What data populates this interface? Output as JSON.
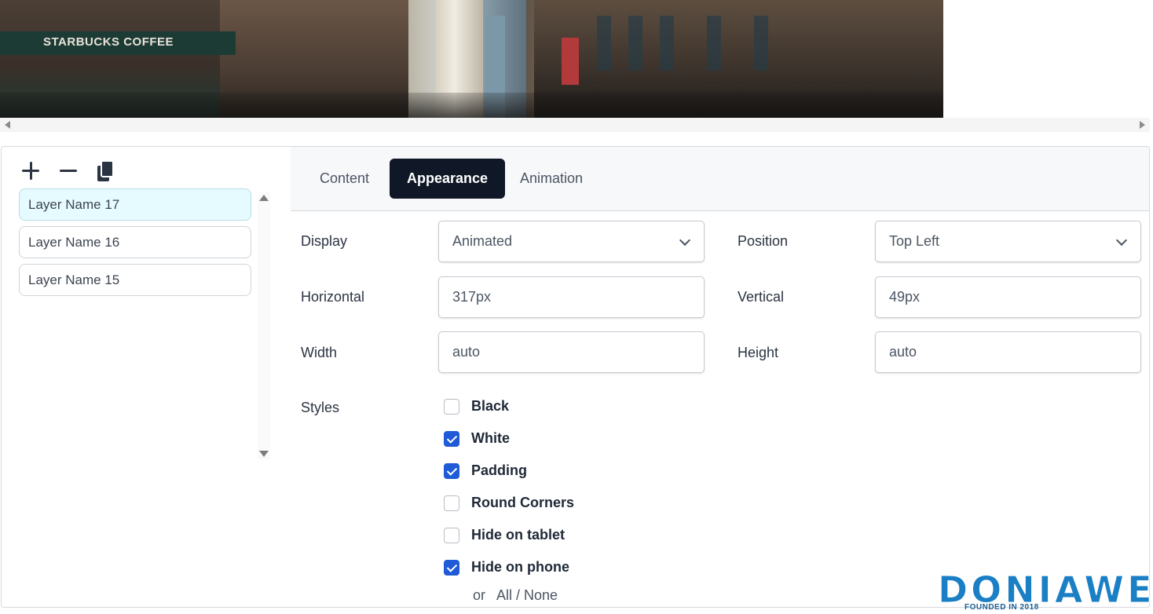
{
  "banner": {
    "sign_text": "STARBUCKS COFFEE"
  },
  "layer_tools": {
    "add_icon": "plus-icon",
    "remove_icon": "minus-icon",
    "duplicate_icon": "copy-icon"
  },
  "layers": {
    "items": [
      {
        "label": "Layer Name 17",
        "active": true
      },
      {
        "label": "Layer Name 16",
        "active": false
      },
      {
        "label": "Layer Name 15",
        "active": false
      }
    ]
  },
  "tabs": [
    {
      "label": "Content",
      "active": false
    },
    {
      "label": "Appearance",
      "active": true
    },
    {
      "label": "Animation",
      "active": false
    }
  ],
  "fields": {
    "display": {
      "label": "Display",
      "value": "Animated"
    },
    "position": {
      "label": "Position",
      "value": "Top Left"
    },
    "horizontal": {
      "label": "Horizontal",
      "value": "317px"
    },
    "vertical": {
      "label": "Vertical",
      "value": "49px"
    },
    "width": {
      "label": "Width",
      "value": "auto"
    },
    "height": {
      "label": "Height",
      "value": "auto"
    }
  },
  "styles": {
    "label": "Styles",
    "options": [
      {
        "label": "Black",
        "checked": false
      },
      {
        "label": "White",
        "checked": true
      },
      {
        "label": "Padding",
        "checked": true
      },
      {
        "label": "Round Corners",
        "checked": false
      },
      {
        "label": "Hide on tablet",
        "checked": false
      },
      {
        "label": "Hide on phone",
        "checked": true
      }
    ],
    "or_text": "or",
    "all_none": "All / None"
  },
  "watermark": {
    "name": "DONIAWEB",
    "tagline": "FOUNDED IN 2018"
  },
  "colors": {
    "accent": "#1f5bd6",
    "active_tab": "#101827",
    "active_layer": "#e6fbff"
  }
}
